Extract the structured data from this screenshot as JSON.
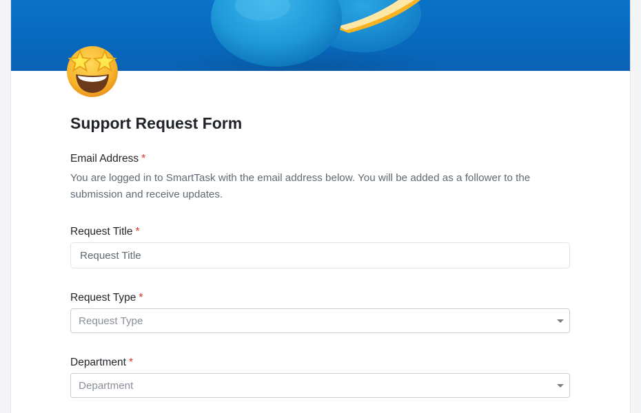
{
  "form": {
    "title": "Support Request Form",
    "required_marker": "*",
    "email": {
      "label": "Email Address",
      "help_text": "You are logged in to SmartTask with the email address below. You will be added as a follower to the submission and receive updates."
    },
    "request_title": {
      "label": "Request Title",
      "placeholder": "Request Title"
    },
    "request_type": {
      "label": "Request Type",
      "placeholder": "Request Type"
    },
    "department": {
      "label": "Department",
      "placeholder": "Department"
    }
  },
  "header": {
    "banner_image": "blue-oranges-photo",
    "avatar_icon": "star-struck-emoji-icon"
  },
  "colors": {
    "required": "#d93025",
    "banner_blue": "#0868bd",
    "text": "#1f2328",
    "muted": "#5f6873"
  }
}
